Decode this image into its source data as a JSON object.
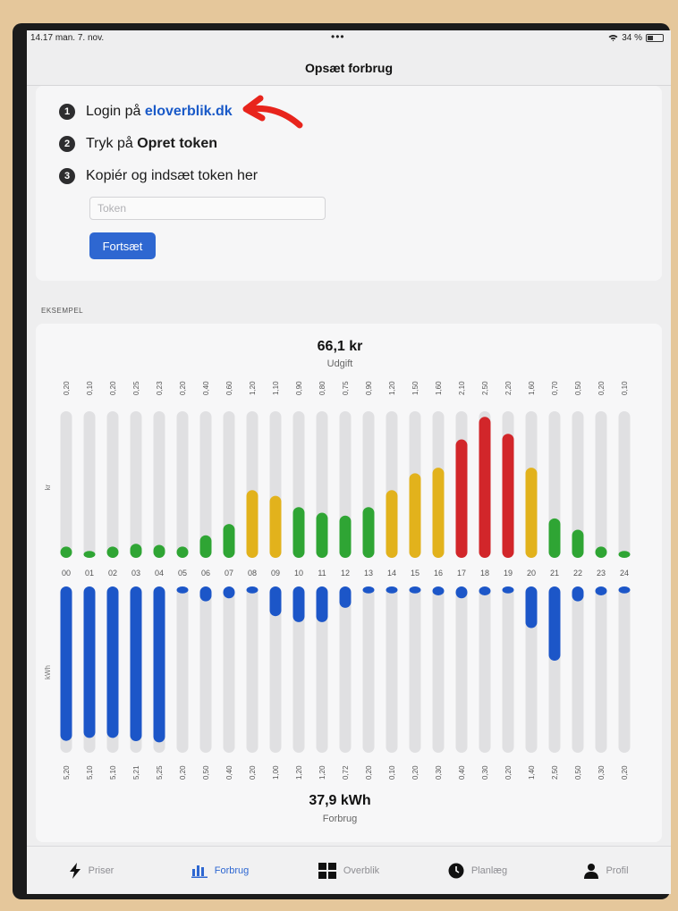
{
  "status": {
    "time": "14.17",
    "date": "man. 7. nov.",
    "battery": "34 %"
  },
  "nav": {
    "title": "Opsæt forbrug"
  },
  "setup": {
    "steps": [
      {
        "num": "1",
        "prefix": "Login på ",
        "highlight": "eloverblik.dk",
        "suffix": ""
      },
      {
        "num": "2",
        "prefix": "Tryk på ",
        "highlight": "Opret token",
        "suffix": ""
      },
      {
        "num": "3",
        "prefix": "Kopiér og indsæt token her",
        "highlight": "",
        "suffix": ""
      }
    ],
    "token_placeholder": "Token",
    "token_value": "",
    "continue_label": "Fortsæt"
  },
  "example_label": "EKSEMPEL",
  "chart_data": {
    "type": "bar",
    "categories": [
      "00",
      "01",
      "02",
      "03",
      "04",
      "05",
      "06",
      "07",
      "08",
      "09",
      "10",
      "11",
      "12",
      "13",
      "14",
      "15",
      "16",
      "17",
      "18",
      "19",
      "20",
      "21",
      "22",
      "23",
      "24"
    ],
    "cost": {
      "total": "66,1 kr",
      "caption": "Udgift",
      "axis_label": "kr",
      "labels": [
        "0,20",
        "0,10",
        "0,20",
        "0,25",
        "0,23",
        "0,20",
        "0,40",
        "0,60",
        "1,20",
        "1,10",
        "0,90",
        "0,80",
        "0,75",
        "0,90",
        "1,20",
        "1,50",
        "1,60",
        "2,10",
        "2,50",
        "2,20",
        "1,60",
        "0,70",
        "0,50",
        "0,20",
        "0,10"
      ],
      "values": [
        0.2,
        0.1,
        0.2,
        0.25,
        0.23,
        0.2,
        0.4,
        0.6,
        1.2,
        1.1,
        0.9,
        0.8,
        0.75,
        0.9,
        1.2,
        1.5,
        1.6,
        2.1,
        2.5,
        2.2,
        1.6,
        0.7,
        0.5,
        0.2,
        0.1
      ],
      "colors": [
        "green",
        "green",
        "green",
        "green",
        "green",
        "green",
        "green",
        "green",
        "yellow",
        "yellow",
        "green",
        "green",
        "green",
        "green",
        "yellow",
        "yellow",
        "yellow",
        "red",
        "red",
        "red",
        "yellow",
        "green",
        "green",
        "green",
        "green"
      ]
    },
    "usage": {
      "total": "37,9 kWh",
      "caption": "Forbrug",
      "axis_label": "kWh",
      "labels": [
        "5,20",
        "5,10",
        "5,10",
        "5,21",
        "5,25",
        "0,20",
        "0,50",
        "0,40",
        "0,20",
        "1,00",
        "1,20",
        "1,20",
        "0,72",
        "0,20",
        "0,10",
        "0,20",
        "0,30",
        "0,40",
        "0,30",
        "0,20",
        "1,40",
        "2,50",
        "0,50",
        "0,30",
        "0,20"
      ],
      "values": [
        5.2,
        5.1,
        5.1,
        5.21,
        5.25,
        0.2,
        0.5,
        0.4,
        0.2,
        1.0,
        1.2,
        1.2,
        0.72,
        0.2,
        0.1,
        0.2,
        0.3,
        0.4,
        0.3,
        0.2,
        1.4,
        2.5,
        0.5,
        0.3,
        0.2
      ]
    },
    "palette": {
      "green": "#2fa534",
      "yellow": "#e2b21c",
      "red": "#d2262a",
      "blue": "#1c56c8",
      "track": "#e0e0e2"
    }
  },
  "tabs": [
    {
      "label": "Priser",
      "icon": "bolt-icon",
      "active": false
    },
    {
      "label": "Forbrug",
      "icon": "bar-chart-icon",
      "active": true
    },
    {
      "label": "Overblik",
      "icon": "grid-icon",
      "active": false
    },
    {
      "label": "Planlæg",
      "icon": "clock-icon",
      "active": false
    },
    {
      "label": "Profil",
      "icon": "person-icon",
      "active": false
    }
  ]
}
